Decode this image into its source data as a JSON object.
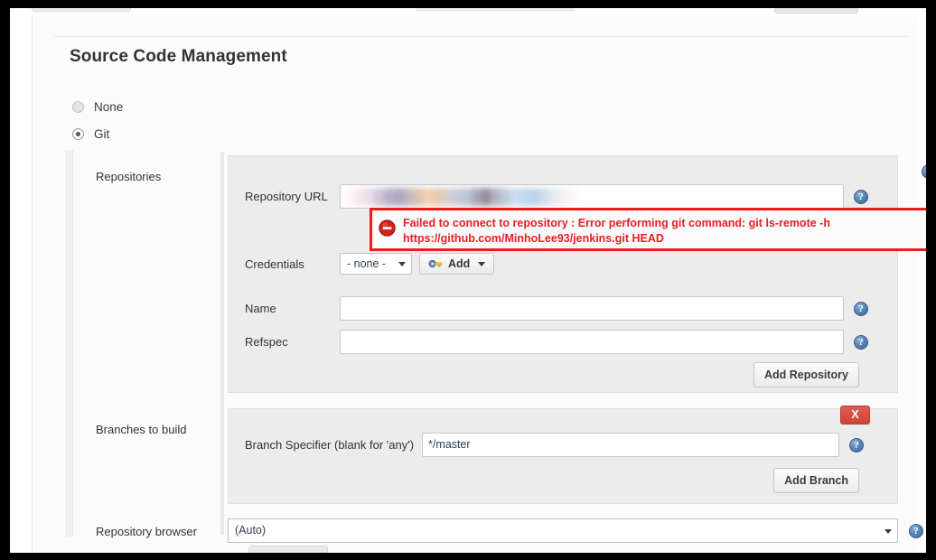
{
  "window": {
    "frame_color": "#000000",
    "page_background": "#fbfbfb"
  },
  "section": {
    "title": "Source Code Management"
  },
  "scm_type": {
    "options": [
      {
        "label": "None",
        "selected": false
      },
      {
        "label": "Git",
        "selected": true
      }
    ]
  },
  "repositories": {
    "label": "Repositories",
    "fields": {
      "repository_url": {
        "label": "Repository URL",
        "value": "",
        "value_redacted": true,
        "help_icon": "help-icon"
      },
      "credentials": {
        "label": "Credentials",
        "selected": "- none -",
        "options": [
          "- none -"
        ],
        "add_label": "Add",
        "add_icon": "key-icon",
        "help_icon": "help-icon"
      },
      "name": {
        "label": "Name",
        "value": "",
        "help_icon": "help-icon"
      },
      "refspec": {
        "label": "Refspec",
        "value": "",
        "help_icon": "help-icon"
      }
    },
    "add_repository_label": "Add Repository",
    "panel_help_icon": "help-icon"
  },
  "error": {
    "icon": "error-circle-minus-icon",
    "line1": "Failed to connect to repository : Error performing git command: git ls-remote -h",
    "line2": "https://github.com/MinhoLee93/jenkins.git HEAD",
    "border_color": "#ef1b1b",
    "text_color": "#ed1c24"
  },
  "branches": {
    "label": "Branches to build",
    "delete_label": "X",
    "delete_color": "#cf4438",
    "specifier": {
      "label": "Branch Specifier (blank for 'any')",
      "value": "*/master",
      "help_icon": "help-icon"
    },
    "add_branch_label": "Add Branch"
  },
  "repository_browser": {
    "label": "Repository browser",
    "selected": "(Auto)",
    "options": [
      "(Auto)"
    ],
    "help_icon": "help-icon"
  },
  "redacted_blocks": [
    "#fdf3f4",
    "#f6e7ea",
    "#e9dde6",
    "#cfc6d6",
    "#b4aec6",
    "#a9a3bd",
    "#c0b2bb",
    "#d9bfb5",
    "#f0cfae",
    "#e8c7ad",
    "#d6cbcf",
    "#c3c9d8",
    "#b9c4d6",
    "#a79fb4",
    "#8f8799",
    "#b0aebb",
    "#bcc9d4",
    "#c9dced",
    "#bcd6ec",
    "#b7d2ea",
    "#cfdcea",
    "#e4e9f1",
    "#f6eef0",
    "#fdf6f6"
  ]
}
